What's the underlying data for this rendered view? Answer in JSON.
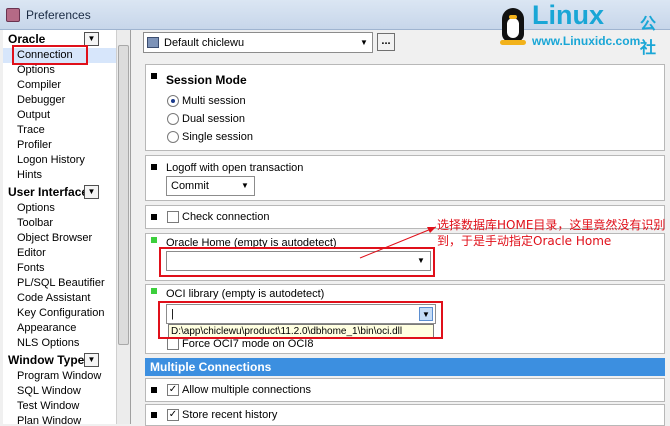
{
  "window": {
    "title": "Preferences"
  },
  "watermark": {
    "brand": "Linux",
    "brand_cn": "公社",
    "url": "www.Linuxidc.com"
  },
  "sidebar": {
    "groups": [
      {
        "label": "Oracle",
        "items": [
          "Connection",
          "Options",
          "Compiler",
          "Debugger",
          "Output",
          "Trace",
          "Profiler",
          "Logon History",
          "Hints"
        ]
      },
      {
        "label": "User Interface",
        "items": [
          "Options",
          "Toolbar",
          "Object Browser",
          "Editor",
          "Fonts",
          "PL/SQL Beautifier",
          "Code Assistant",
          "Key Configuration",
          "Appearance",
          "NLS Options"
        ]
      },
      {
        "label": "Window Types",
        "items": [
          "Program Window",
          "SQL Window",
          "Test Window",
          "Plan Window"
        ]
      }
    ],
    "selected": "Connection"
  },
  "profile": {
    "value": "Default chiclewu",
    "ellipsis": "..."
  },
  "session": {
    "title": "Session Mode",
    "options": [
      "Multi session",
      "Dual session",
      "Single session"
    ],
    "selected": "Multi session"
  },
  "logoff": {
    "label": "Logoff with open transaction",
    "value": "Commit"
  },
  "check_connection": {
    "label": "Check connection",
    "checked": false
  },
  "oracle_home": {
    "label": "Oracle Home (empty is autodetect)",
    "value": ""
  },
  "oci_library": {
    "label": "OCI library (empty is autodetect)",
    "value": "|",
    "suggestion": "D:\\app\\chiclewu\\product\\11.2.0\\dbhome_1\\bin\\oci.dll"
  },
  "force_oci7": {
    "label": "Force OCI7 mode on OCI8"
  },
  "multiple_connections": {
    "title": "Multiple Connections",
    "allow_label": "Allow multiple connections",
    "recent_label": "Store recent history"
  },
  "annotation": "选择数据库HOME目录，这里竟然没有识别到，于是手动指定Oracle Home",
  "colors": {
    "highlight": "#e0101a",
    "header_blue": "#3c8fe0",
    "brand": "#19a6d6"
  }
}
